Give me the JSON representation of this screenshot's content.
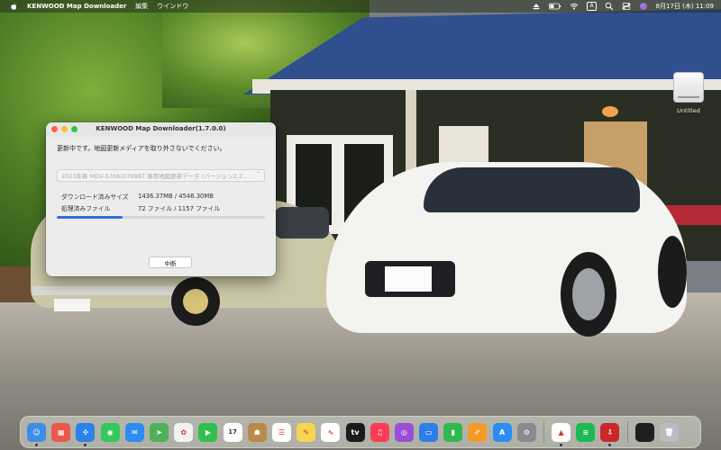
{
  "menubar": {
    "app_name": "KENWOOD Map Downloader",
    "menus": [
      "編集",
      "ウインドウ"
    ],
    "input_mode": "A",
    "datetime": "8月17日 (木)  11:09"
  },
  "desktop": {
    "icons": [
      {
        "label": "Untitled",
        "icon": "external-drive-icon"
      }
    ]
  },
  "window": {
    "title": "KENWOOD Map Downloader(1.7.0.0)",
    "message": "更新中です。地図更新メディアを取り外さないでください。",
    "select_value": "2023年春 MDV-S708/D708BT 専用地図更新データ (バージョン2.2....",
    "downloaded_label": "ダウンロード済みサイズ",
    "downloaded_value": "1436.37MB / 4546.30MB",
    "processed_label": "処理済みファイル",
    "processed_value": "72 ファイル / 1157 ファイル",
    "progress_fraction": 0.316,
    "cancel_label": "中断"
  },
  "dock": {
    "apps": [
      {
        "name": "finder",
        "color": "#3d8fe6",
        "glyph": "☺"
      },
      {
        "name": "launchpad",
        "color": "#e8584d",
        "glyph": "▦"
      },
      {
        "name": "safari",
        "color": "#2b82e8",
        "glyph": "✣"
      },
      {
        "name": "messages",
        "color": "#34c759",
        "glyph": "◉"
      },
      {
        "name": "mail",
        "color": "#2d8cf0",
        "glyph": "✉"
      },
      {
        "name": "maps",
        "color": "#4fb25a",
        "glyph": "➤"
      },
      {
        "name": "photos",
        "color": "#f2f2f2",
        "glyph": "✿"
      },
      {
        "name": "facetime",
        "color": "#30c04e",
        "glyph": "▶"
      },
      {
        "name": "calendar",
        "color": "#ffffff",
        "glyph": "17"
      },
      {
        "name": "contacts",
        "color": "#b98a4a",
        "glyph": "☗"
      },
      {
        "name": "reminders",
        "color": "#ffffff",
        "glyph": "☰"
      },
      {
        "name": "notes",
        "color": "#f7d552",
        "glyph": "✎"
      },
      {
        "name": "freeform",
        "color": "#ffffff",
        "glyph": "∿"
      },
      {
        "name": "apple-tv",
        "color": "#1b1b1b",
        "glyph": "tv"
      },
      {
        "name": "music",
        "color": "#fa3c55",
        "glyph": "♫"
      },
      {
        "name": "podcasts",
        "color": "#9a4fd6",
        "glyph": "◎"
      },
      {
        "name": "keynote",
        "color": "#2f7ee8",
        "glyph": "▭"
      },
      {
        "name": "numbers",
        "color": "#2fb94f",
        "glyph": "▮"
      },
      {
        "name": "pages",
        "color": "#f59a29",
        "glyph": "✐"
      },
      {
        "name": "app-store",
        "color": "#2b8cf2",
        "glyph": "A"
      },
      {
        "name": "system-settings",
        "color": "#8a8a8f",
        "glyph": "⚙"
      },
      {
        "name": "preview",
        "color": "#ffffff",
        "glyph": "▲"
      },
      {
        "name": "spotify",
        "color": "#1db954",
        "glyph": "≋"
      },
      {
        "name": "kenwood-map-downloader",
        "color": "#c9272c",
        "glyph": "⇩"
      },
      {
        "name": "screen",
        "color": "#1f1f1f",
        "glyph": ""
      },
      {
        "name": "trash",
        "color": "#b9bcc0",
        "glyph": "🗑"
      }
    ]
  }
}
